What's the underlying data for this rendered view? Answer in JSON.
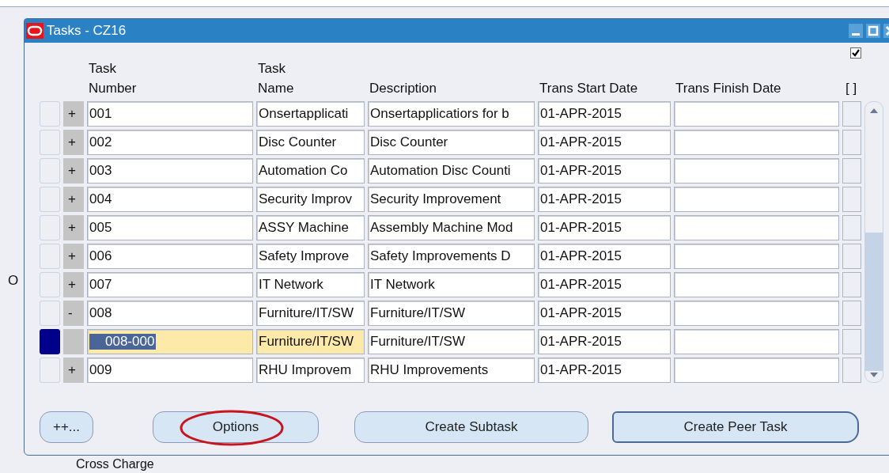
{
  "background": {
    "side_label": "O",
    "bottom_label": "Cross Charge"
  },
  "window": {
    "title": "Tasks - CZ16"
  },
  "top_checkbox": {
    "checked": true
  },
  "table": {
    "columns": [
      {
        "label": "Task\nNumber"
      },
      {
        "label": "Task\nName"
      },
      {
        "label": "Description"
      },
      {
        "label": "Trans Start Date"
      },
      {
        "label": "Trans Finish Date"
      },
      {
        "label": "[ ]"
      }
    ],
    "rows": [
      {
        "selected": false,
        "expander": "+",
        "number": "001",
        "name": "Onsertapplicati",
        "description": "Onsertapplicatiors for b",
        "start": "01-APR-2015"
      },
      {
        "selected": false,
        "expander": "+",
        "number": "002",
        "name": "Disc Counter",
        "description": "Disc Counter",
        "start": "01-APR-2015"
      },
      {
        "selected": false,
        "expander": "+",
        "number": "003",
        "name": "Automation Co",
        "description": "Automation Disc Counti",
        "start": "01-APR-2015"
      },
      {
        "selected": false,
        "expander": "+",
        "number": "004",
        "name": "Security Improv",
        "description": "Security Improvement",
        "start": "01-APR-2015"
      },
      {
        "selected": false,
        "expander": "+",
        "number": "005",
        "name": "ASSY Machine",
        "description": "Assembly Machine Mod",
        "start": "01-APR-2015"
      },
      {
        "selected": false,
        "expander": "+",
        "number": "006",
        "name": "Safety Improve",
        "description": "Safety Improvements D",
        "start": "01-APR-2015"
      },
      {
        "selected": false,
        "expander": "+",
        "number": "007",
        "name": "IT Network",
        "description": "IT Network",
        "start": "01-APR-2015"
      },
      {
        "selected": false,
        "expander": "-",
        "number": "008",
        "name": "Furniture/IT/SW",
        "description": "Furniture/IT/SW",
        "start": "01-APR-2015"
      },
      {
        "selected": true,
        "number": "008-000",
        "name": "Furniture/IT/SW",
        "description": "Furniture/IT/SW",
        "start": "01-APR-2015"
      },
      {
        "selected": false,
        "expander": "+",
        "number": "009",
        "name": "RHU Improvem",
        "description": "RHU Improvements",
        "start": "01-APR-2015"
      }
    ]
  },
  "buttons": [
    {
      "label": "++...",
      "default": false,
      "circled": false
    },
    {
      "label": "Options",
      "default": false,
      "circled": true
    },
    {
      "label": "Create Subtask",
      "default": false,
      "circled": false
    },
    {
      "label": "Create Peer Task",
      "default": true,
      "circled": false
    }
  ]
}
